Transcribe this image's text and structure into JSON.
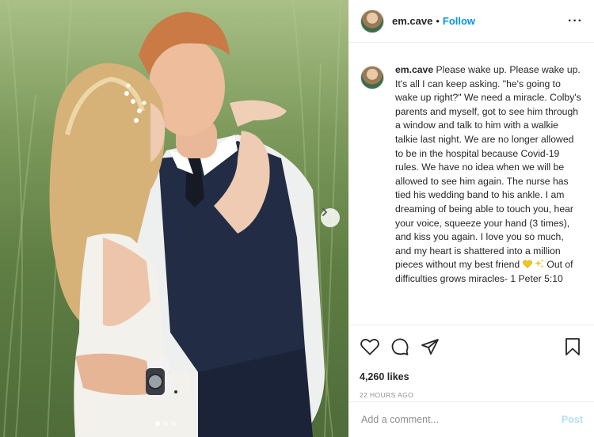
{
  "post": {
    "username": "em.cave",
    "separator": "•",
    "follow_label": "Follow",
    "more_label": "···"
  },
  "caption": {
    "username": "em.cave",
    "text_main": "Please wake up. Please wake up. It's all I can keep asking. \"he's going to wake up right?\" We need a miracle. Colby's parents and myself, got to see him through a window and talk to him with a walkie talkie last night. We are no longer allowed to be in the hospital because Covid-19 rules. We have no idea when we will be allowed to see him again. The nurse has tied his wedding band to his ankle. I am dreaming of being able to touch you, hear your voice, squeeze your hand (3 times), and kiss you again. I love you so much, and my heart is shattered into a million pieces without my best friend",
    "text_end": "Out of difficulties grows miracles- 1 Peter 5:10",
    "emojis": [
      "yellow-heart",
      "sparkles"
    ]
  },
  "stats": {
    "likes": "4,260 likes",
    "time": "22 HOURS AGO"
  },
  "comment_box": {
    "placeholder": "Add a comment...",
    "post_label": "Post"
  },
  "carousel": {
    "slides": 3,
    "active_index": 0
  },
  "colors": {
    "accent": "#0095f6",
    "post_disabled": "#b2dffc",
    "text": "#262626",
    "muted": "#8e8e8e"
  }
}
